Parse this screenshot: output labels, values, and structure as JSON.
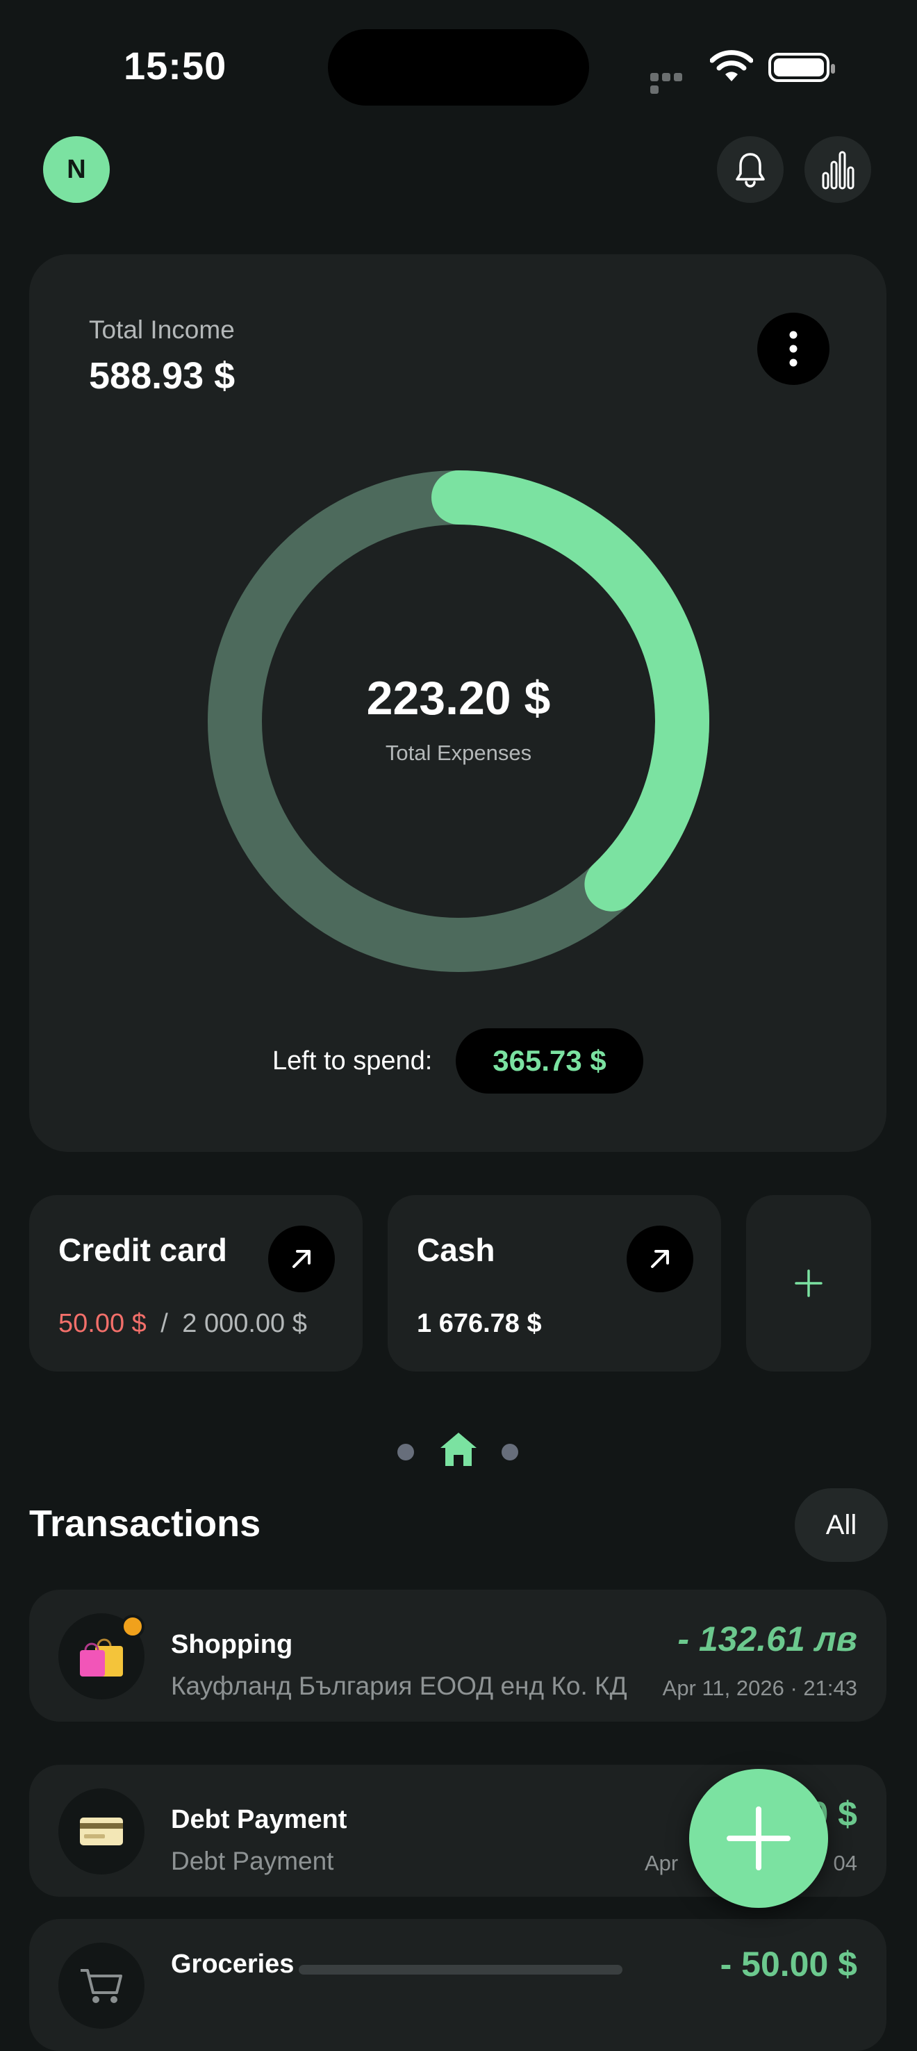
{
  "status_bar": {
    "time": "15:50"
  },
  "header": {
    "avatar_initial": "N"
  },
  "summary": {
    "income_label": "Total Income",
    "income_value": "588.93 $",
    "expenses_value": "223.20 $",
    "expenses_label": "Total Expenses",
    "expenses_share": 0.38,
    "left_label": "Left to spend:",
    "left_value": "365.73 $"
  },
  "accounts": [
    {
      "title": "Credit card",
      "used": "50.00 $",
      "separator": "/",
      "limit": "2 000.00 $"
    },
    {
      "title": "Cash",
      "balance": "1 676.78 $"
    }
  ],
  "transactions": {
    "title": "Transactions",
    "filter_label": "All",
    "items": [
      {
        "name": "Shopping",
        "sub": "Кауфланд България ЕООД енд Ко. КД",
        "amount": "- 132.61 лв",
        "date": "Apr 11, 2026 · 21:43",
        "icon": "shopping-bags-icon"
      },
      {
        "name": "Debt Payment",
        "sub": "Debt Payment",
        "amount": "0 $",
        "date": "Apr",
        "date_tail": "04",
        "icon": "credit-card-icon"
      },
      {
        "name": "Groceries",
        "sub": "",
        "amount": "- 50.00 $",
        "date": "",
        "icon": "shopping-cart-icon"
      }
    ]
  },
  "colors": {
    "accent": "#7be2a1",
    "ring_track": "#4d6a5c",
    "negative": "#f26f6a",
    "background": "#121616",
    "card": "#1d2121"
  }
}
